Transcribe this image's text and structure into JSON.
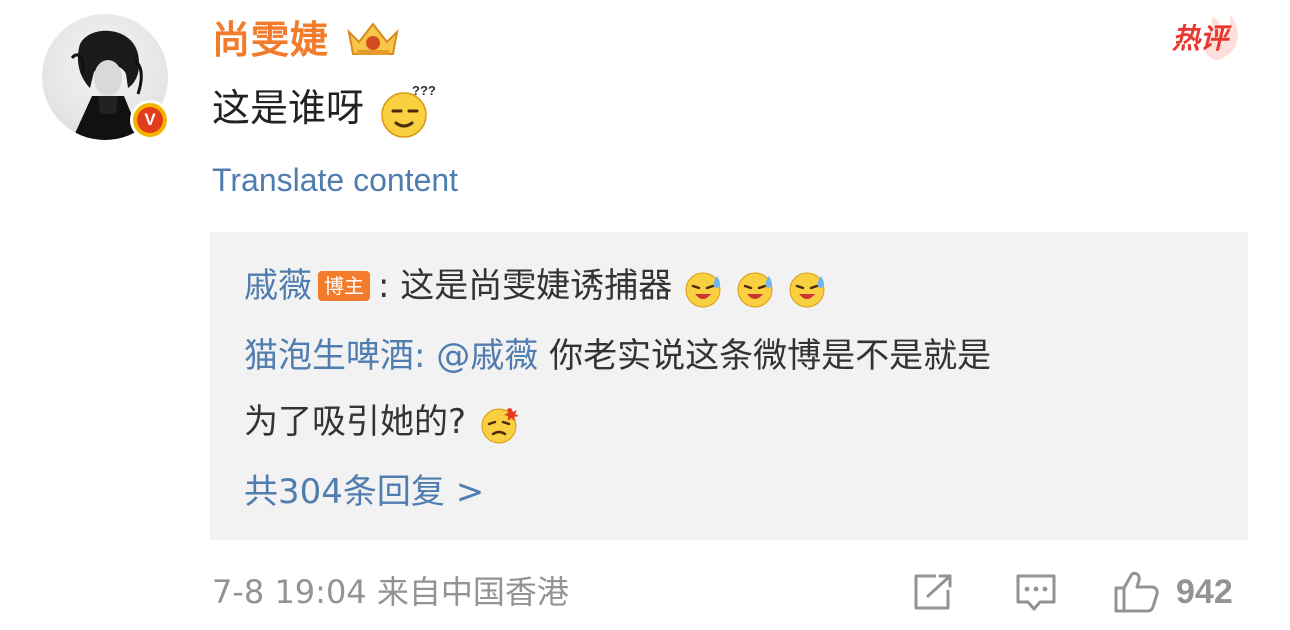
{
  "comment": {
    "author": "尚雯婕",
    "text": "这是谁呀",
    "translate_label": "Translate content",
    "hot_badge": "热评",
    "verified_badge": "V",
    "icons": {
      "crown": "crown-icon",
      "emoji_confused": "confused-emoji-icon"
    }
  },
  "replies": {
    "first": {
      "author": "戚薇",
      "tag": "博主",
      "separator": ":",
      "text": "这是尚雯婕诱捕器"
    },
    "second": {
      "author": "猫泡生啤酒:",
      "mention": "@戚薇",
      "text_line1": "你老实说这条微博是不是就是",
      "text_line2": "为了吸引她的?"
    },
    "more_label": "共304条回复 >"
  },
  "footer": {
    "date_time": "7-8 19:04",
    "source": "来自中国香港",
    "like_count": "942"
  },
  "colors": {
    "author": "#f27c2c",
    "link": "#507daf",
    "meta": "#939393",
    "hot": "#e8392f",
    "reply_bg": "#f2f2f2"
  }
}
